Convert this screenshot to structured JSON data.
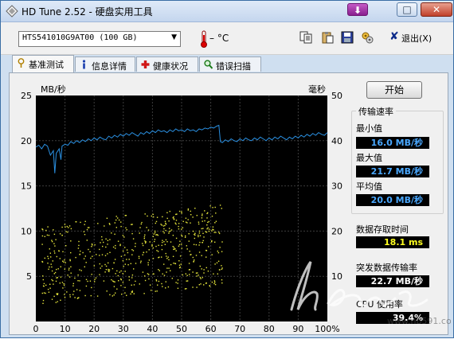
{
  "window": {
    "title": "HD Tune 2.52 - 硬盘实用工具"
  },
  "toolbar": {
    "drive": "HTS541010G9AT00  (100 GB)",
    "temperature": "– °C",
    "exit_label": "退出(X)"
  },
  "tabs": [
    {
      "label": "基准测试",
      "icon": "benchmark-icon"
    },
    {
      "label": "信息详情",
      "icon": "info-icon"
    },
    {
      "label": "健康状况",
      "icon": "health-cross-icon"
    },
    {
      "label": "错误扫描",
      "icon": "magnifier-icon"
    }
  ],
  "side": {
    "start_button": "开始",
    "transfer_rate": "传输速率",
    "min_label": "最小值",
    "min_value": "16.0 MB/秒",
    "max_label": "最大值",
    "max_value": "21.7 MB/秒",
    "avg_label": "平均值",
    "avg_value": "20.0 MB/秒",
    "access_label": "数据存取时间",
    "access_value": "18.1 ms",
    "burst_label": "突发数据传输率",
    "burst_value": "22.7 MB/秒",
    "cpu_label": "CPU 使用率",
    "cpu_value": "39.4%"
  },
  "chart_data": {
    "type": "line",
    "left_unit": "MB/秒",
    "right_unit": "毫秒",
    "y_left": {
      "min": 0,
      "max": 25,
      "ticks": [
        "25",
        "20",
        "15",
        "10",
        "5"
      ]
    },
    "y_right": {
      "min": 0,
      "max": 50,
      "ticks": [
        "50",
        "40",
        "30",
        "20",
        "10"
      ]
    },
    "x": {
      "min": 0,
      "max": 100,
      "ticks": [
        "0",
        "10",
        "20",
        "30",
        "40",
        "50",
        "60",
        "70",
        "80",
        "90",
        "100%"
      ]
    },
    "series": [
      {
        "name": "transfer-rate",
        "color": "#2a8fe0",
        "points": [
          [
            0,
            19.3
          ],
          [
            1,
            19.5
          ],
          [
            2,
            19.1
          ],
          [
            3,
            19.6
          ],
          [
            4,
            19.4
          ],
          [
            5,
            18.4
          ],
          [
            6,
            18.9
          ],
          [
            6.5,
            16.4
          ],
          [
            7,
            18.6
          ],
          [
            8,
            19.1
          ],
          [
            8.6,
            17.9
          ],
          [
            9,
            19.4
          ],
          [
            10,
            19.6
          ],
          [
            11,
            19.5
          ],
          [
            12,
            19.9
          ],
          [
            13,
            19.7
          ],
          [
            14,
            20.0
          ],
          [
            15,
            19.8
          ],
          [
            16,
            20.1
          ],
          [
            17,
            19.9
          ],
          [
            18,
            20.2
          ],
          [
            19,
            20.0
          ],
          [
            20,
            20.3
          ],
          [
            21,
            20.1
          ],
          [
            22,
            20.4
          ],
          [
            23,
            20.2
          ],
          [
            24,
            20.1
          ],
          [
            25,
            20.5
          ],
          [
            26,
            20.3
          ],
          [
            27,
            20.6
          ],
          [
            28,
            20.4
          ],
          [
            29,
            20.7
          ],
          [
            30,
            20.5
          ],
          [
            31,
            20.8
          ],
          [
            32,
            20.6
          ],
          [
            33,
            20.9
          ],
          [
            34,
            20.7
          ],
          [
            35,
            20.5
          ],
          [
            36,
            20.9
          ],
          [
            37,
            20.7
          ],
          [
            38,
            21.0
          ],
          [
            39,
            20.8
          ],
          [
            40,
            21.1
          ],
          [
            41,
            20.9
          ],
          [
            42,
            21.2
          ],
          [
            43,
            21.0
          ],
          [
            44,
            21.1
          ],
          [
            45,
            20.9
          ],
          [
            46,
            21.2
          ],
          [
            47,
            21.0
          ],
          [
            48,
            21.3
          ],
          [
            49,
            21.1
          ],
          [
            50,
            21.2
          ],
          [
            51,
            21.0
          ],
          [
            52,
            21.3
          ],
          [
            53,
            21.1
          ],
          [
            54,
            21.2
          ],
          [
            55,
            21.0
          ],
          [
            56,
            21.3
          ],
          [
            57,
            21.2
          ],
          [
            58,
            21.4
          ],
          [
            59,
            21.3
          ],
          [
            60,
            21.5
          ],
          [
            61,
            21.4
          ],
          [
            62,
            21.6
          ],
          [
            62.8,
            21.7
          ],
          [
            63.3,
            19.9
          ],
          [
            64,
            19.8
          ],
          [
            65,
            20.1
          ],
          [
            66,
            19.9
          ],
          [
            67,
            20.2
          ],
          [
            68,
            20.0
          ],
          [
            69,
            19.9
          ],
          [
            70,
            20.2
          ],
          [
            71,
            20.0
          ],
          [
            72,
            20.3
          ],
          [
            73,
            20.1
          ],
          [
            74,
            20.0
          ],
          [
            75,
            20.3
          ],
          [
            76,
            20.1
          ],
          [
            77,
            20.4
          ],
          [
            78,
            20.2
          ],
          [
            79,
            20.0
          ],
          [
            80,
            20.3
          ],
          [
            81,
            20.1
          ],
          [
            82,
            20.4
          ],
          [
            83,
            20.2
          ],
          [
            84,
            20.5
          ],
          [
            85,
            20.3
          ],
          [
            86,
            20.1
          ],
          [
            87,
            20.4
          ],
          [
            88,
            20.2
          ],
          [
            89,
            20.5
          ],
          [
            90,
            20.3
          ],
          [
            91,
            20.6
          ],
          [
            92,
            20.4
          ],
          [
            93,
            20.7
          ],
          [
            94,
            20.5
          ],
          [
            95,
            20.8
          ],
          [
            96,
            20.6
          ],
          [
            97,
            20.9
          ],
          [
            98,
            20.7
          ],
          [
            99,
            20.6
          ],
          [
            100,
            20.9
          ]
        ]
      },
      {
        "name": "access-time",
        "type": "scatter",
        "color": "#e6e63c",
        "x_range": [
          2,
          64
        ],
        "y_range_ms": [
          4,
          26
        ]
      }
    ]
  },
  "watermark": {
    "text": "www.nb591.com"
  }
}
